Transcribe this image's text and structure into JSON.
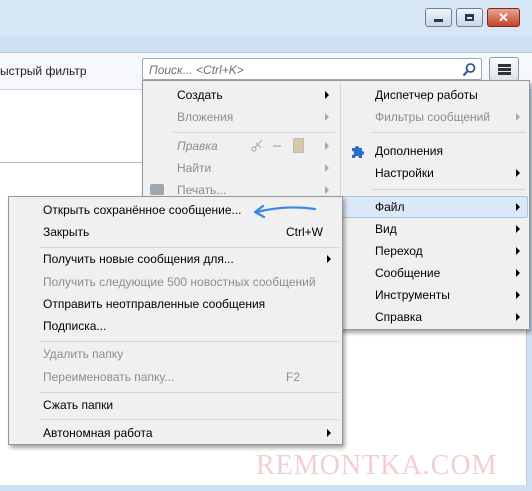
{
  "toolbar": {
    "quick_filter_label": "ыстрый фильтр",
    "search_placeholder": "Поиск... <Ctrl+K>"
  },
  "app_menu": {
    "left_column": [
      {
        "label": "Создать",
        "enabled": true,
        "submenu": true
      },
      {
        "label": "Вложения",
        "enabled": false,
        "submenu": true
      },
      {
        "label": "Правка",
        "enabled": false,
        "submenu": true
      },
      {
        "label": "Найти",
        "enabled": false,
        "submenu": true
      },
      {
        "label": "Печать...",
        "enabled": false,
        "submenu": true
      }
    ],
    "right_column": [
      {
        "label": "Диспетчер работы",
        "enabled": true,
        "submenu": false
      },
      {
        "label": "Фильтры сообщений",
        "enabled": false,
        "submenu": true
      },
      {
        "label": "Дополнения",
        "enabled": true,
        "submenu": false
      },
      {
        "label": "Настройки",
        "enabled": true,
        "submenu": true
      },
      {
        "label": "Файл",
        "enabled": true,
        "submenu": true,
        "highlighted": true
      },
      {
        "label": "Вид",
        "enabled": true,
        "submenu": true
      },
      {
        "label": "Переход",
        "enabled": true,
        "submenu": true
      },
      {
        "label": "Сообщение",
        "enabled": true,
        "submenu": true
      },
      {
        "label": "Инструменты",
        "enabled": true,
        "submenu": true
      },
      {
        "label": "Справка",
        "enabled": true,
        "submenu": true
      }
    ]
  },
  "file_menu": {
    "items": [
      {
        "label": "Открыть сохранённое сообщение...",
        "enabled": true
      },
      {
        "label": "Закрыть",
        "enabled": true,
        "shortcut": "Ctrl+W"
      },
      {
        "label": "Получить новые сообщения для...",
        "enabled": true,
        "submenu": true
      },
      {
        "label": "Получить следующие 500 новостных сообщений",
        "enabled": false
      },
      {
        "label": "Отправить неотправленные сообщения",
        "enabled": true
      },
      {
        "label": "Подписка...",
        "enabled": true
      },
      {
        "label": "Удалить папку",
        "enabled": false
      },
      {
        "label": "Переименовать папку...",
        "enabled": false,
        "shortcut": "F2"
      },
      {
        "label": "Сжать папки",
        "enabled": true
      },
      {
        "label": "Автономная работа",
        "enabled": true,
        "submenu": true
      }
    ]
  },
  "watermark": "REMONTKA.COM",
  "colors": {
    "arrow_annotation": "#3a86e8",
    "highlight": "#dbe8f7",
    "menu_bg": "#f0f0f0"
  }
}
